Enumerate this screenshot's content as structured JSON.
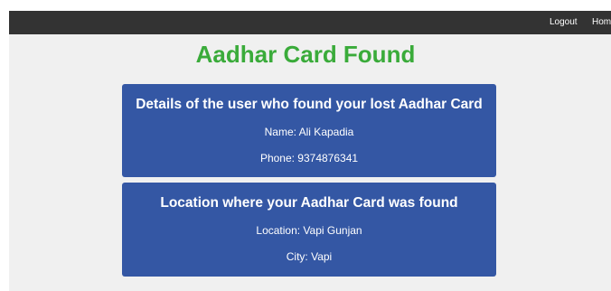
{
  "nav": {
    "logout_label": "Logout",
    "home_label": "Home"
  },
  "page": {
    "title": "Aadhar Card Found"
  },
  "finder_card": {
    "title": "Details of the user who found your lost Aadhar Card",
    "name_line": "Name: Ali Kapadia",
    "phone_line": "Phone: 9374876341"
  },
  "location_card": {
    "title": "Location where your Aadhar Card was found",
    "location_line": "Location: Vapi Gunjan",
    "city_line": "City: Vapi"
  },
  "colors": {
    "navbar": "#333333",
    "page_background": "#f0f0f0",
    "title": "#3aab3a",
    "card": "#3457a4"
  }
}
